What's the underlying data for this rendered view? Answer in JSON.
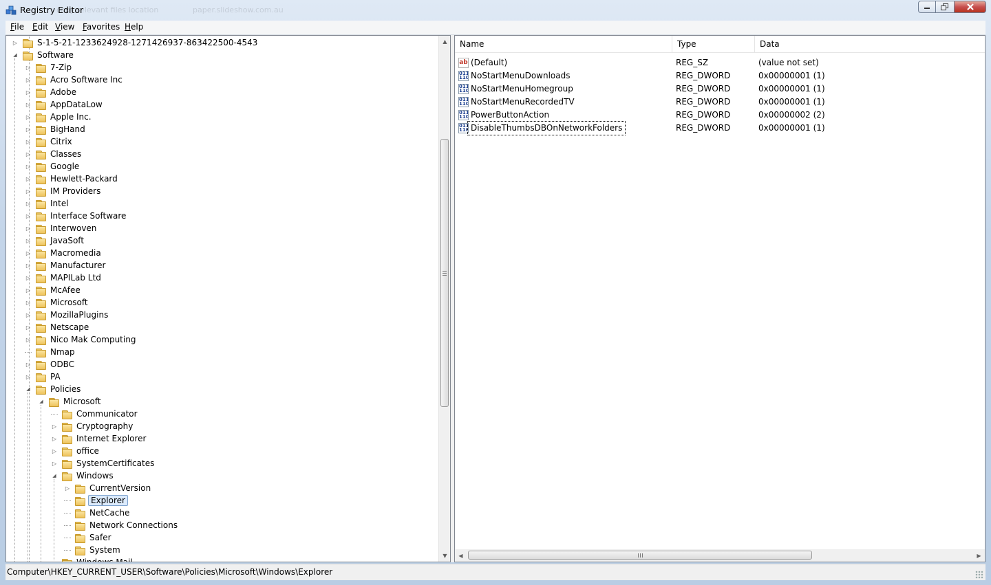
{
  "window": {
    "title": "Registry Editor",
    "ghost_texts": [
      "copy relevant files location",
      "paper.slideshow.com.au"
    ]
  },
  "menu": [
    {
      "label": "File",
      "accel": "F",
      "rest": "ile"
    },
    {
      "label": "Edit",
      "accel": "E",
      "rest": "dit"
    },
    {
      "label": "View",
      "accel": "V",
      "rest": "iew"
    },
    {
      "label": "Favorites",
      "accel": "F",
      "rest": "avorites"
    },
    {
      "label": "Help",
      "accel": "H",
      "rest": "elp"
    }
  ],
  "tree": [
    {
      "label": "S-1-5-21-1233624928-1271426937-863422500-4543",
      "level": 2,
      "exp": "collapsed"
    },
    {
      "label": "Software",
      "level": 2,
      "exp": "expanded"
    },
    {
      "label": "7-Zip",
      "level": 3,
      "exp": "collapsed"
    },
    {
      "label": "Acro Software Inc",
      "level": 3,
      "exp": "collapsed"
    },
    {
      "label": "Adobe",
      "level": 3,
      "exp": "collapsed"
    },
    {
      "label": "AppDataLow",
      "level": 3,
      "exp": "collapsed"
    },
    {
      "label": "Apple Inc.",
      "level": 3,
      "exp": "collapsed"
    },
    {
      "label": "BigHand",
      "level": 3,
      "exp": "collapsed"
    },
    {
      "label": "Citrix",
      "level": 3,
      "exp": "collapsed"
    },
    {
      "label": "Classes",
      "level": 3,
      "exp": "collapsed"
    },
    {
      "label": "Google",
      "level": 3,
      "exp": "collapsed"
    },
    {
      "label": "Hewlett-Packard",
      "level": 3,
      "exp": "collapsed"
    },
    {
      "label": "IM Providers",
      "level": 3,
      "exp": "collapsed"
    },
    {
      "label": "Intel",
      "level": 3,
      "exp": "collapsed"
    },
    {
      "label": "Interface Software",
      "level": 3,
      "exp": "collapsed"
    },
    {
      "label": "Interwoven",
      "level": 3,
      "exp": "collapsed"
    },
    {
      "label": "JavaSoft",
      "level": 3,
      "exp": "collapsed"
    },
    {
      "label": "Macromedia",
      "level": 3,
      "exp": "collapsed"
    },
    {
      "label": "Manufacturer",
      "level": 3,
      "exp": "collapsed"
    },
    {
      "label": "MAPILab Ltd",
      "level": 3,
      "exp": "collapsed"
    },
    {
      "label": "McAfee",
      "level": 3,
      "exp": "collapsed"
    },
    {
      "label": "Microsoft",
      "level": 3,
      "exp": "collapsed"
    },
    {
      "label": "MozillaPlugins",
      "level": 3,
      "exp": "collapsed"
    },
    {
      "label": "Netscape",
      "level": 3,
      "exp": "collapsed"
    },
    {
      "label": "Nico Mak Computing",
      "level": 3,
      "exp": "collapsed"
    },
    {
      "label": "Nmap",
      "level": 3,
      "exp": "none"
    },
    {
      "label": "ODBC",
      "level": 3,
      "exp": "collapsed"
    },
    {
      "label": "PA",
      "level": 3,
      "exp": "collapsed"
    },
    {
      "label": "Policies",
      "level": 3,
      "exp": "expanded"
    },
    {
      "label": "Microsoft",
      "level": 4,
      "exp": "expanded"
    },
    {
      "label": "Communicator",
      "level": 5,
      "exp": "none"
    },
    {
      "label": "Cryptography",
      "level": 5,
      "exp": "collapsed"
    },
    {
      "label": "Internet Explorer",
      "level": 5,
      "exp": "collapsed"
    },
    {
      "label": "office",
      "level": 5,
      "exp": "collapsed"
    },
    {
      "label": "SystemCertificates",
      "level": 5,
      "exp": "collapsed"
    },
    {
      "label": "Windows",
      "level": 5,
      "exp": "expanded"
    },
    {
      "label": "CurrentVersion",
      "level": 6,
      "exp": "collapsed"
    },
    {
      "label": "Explorer",
      "level": 6,
      "exp": "none",
      "selected": true
    },
    {
      "label": "NetCache",
      "level": 6,
      "exp": "none"
    },
    {
      "label": "Network Connections",
      "level": 6,
      "exp": "none"
    },
    {
      "label": "Safer",
      "level": 6,
      "exp": "none"
    },
    {
      "label": "System",
      "level": 6,
      "exp": "none"
    },
    {
      "label": "Windows Mail",
      "level": 5,
      "exp": "none"
    }
  ],
  "list": {
    "columns": [
      "Name",
      "Type",
      "Data"
    ],
    "rows": [
      {
        "name": "(Default)",
        "type": "REG_SZ",
        "data": "(value not set)",
        "icon": "string-value-icon"
      },
      {
        "name": "NoStartMenuDownloads",
        "type": "REG_DWORD",
        "data": "0x00000001 (1)",
        "icon": "dword-value-icon"
      },
      {
        "name": "NoStartMenuHomegroup",
        "type": "REG_DWORD",
        "data": "0x00000001 (1)",
        "icon": "dword-value-icon"
      },
      {
        "name": "NoStartMenuRecordedTV",
        "type": "REG_DWORD",
        "data": "0x00000001 (1)",
        "icon": "dword-value-icon"
      },
      {
        "name": "PowerButtonAction",
        "type": "REG_DWORD",
        "data": "0x00000002 (2)",
        "icon": "dword-value-icon"
      },
      {
        "name": "DisableThumbsDBOnNetworkFolders",
        "type": "REG_DWORD",
        "data": "0x00000001 (1)",
        "icon": "dword-value-icon",
        "focused": true
      }
    ]
  },
  "status": {
    "path": "Computer\\HKEY_CURRENT_USER\\Software\\Policies\\Microsoft\\Windows\\Explorer"
  }
}
